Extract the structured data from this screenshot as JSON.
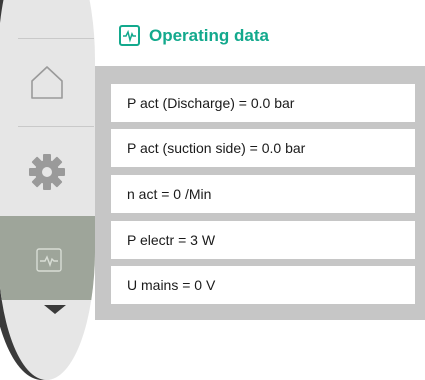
{
  "header": {
    "title": "Operating data",
    "icon": "pulse-icon",
    "accent_color": "#13a98d"
  },
  "sidebar": {
    "items": [
      {
        "name": "home",
        "icon": "home-icon"
      },
      {
        "name": "settings",
        "icon": "gear-icon"
      },
      {
        "name": "operating-data",
        "icon": "pulse-icon",
        "active": true
      }
    ],
    "scroll_icon": "arrow-down-icon"
  },
  "rows": [
    "P act (Discharge) = 0.0 bar",
    "P act (suction side) = 0.0 bar",
    "n act = 0 /Min",
    "P electr = 3 W",
    "U mains = 0 V"
  ]
}
